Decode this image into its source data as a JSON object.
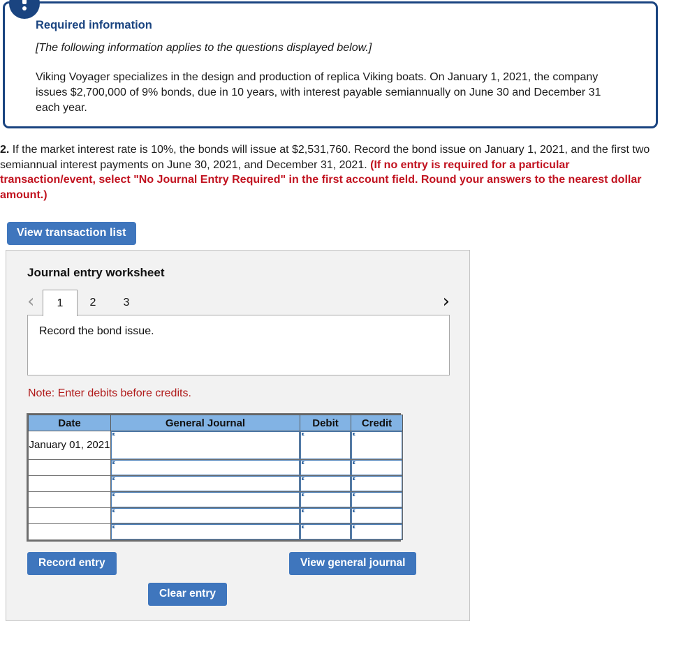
{
  "required_info": {
    "badge_icon": "exclamation-circle-icon",
    "title": "Required information",
    "applies_note": "[The following information applies to the questions displayed below.]",
    "body": "Viking Voyager specializes in the design and production of replica Viking boats. On January 1, 2021, the company issues $2,700,000 of 9% bonds, due in 10 years, with interest payable semiannually on June 30 and December 31 each year.",
    "border_color": "#1a4480",
    "title_color": "#1a4480"
  },
  "question": {
    "number": "2.",
    "text_part1": " If the market interest rate is 10%, the bonds will issue at $2,531,760. Record the bond issue on January 1, 2021, and the first two semiannual interest payments on June 30, 2021, and December 31, 2021. ",
    "emphasis": "(If no entry is required for a particular transaction/event, select \"No Journal Entry Required\" in the first account field. Round your answers to the nearest dollar amount.)",
    "emphasis_color": "#c1121f"
  },
  "toolbar": {
    "view_transaction_list_label": "View transaction list"
  },
  "worksheet": {
    "title": "Journal entry worksheet",
    "prev_icon": "chevron-left-icon",
    "next_icon": "chevron-right-icon",
    "tabs": [
      {
        "label": "1",
        "active": true
      },
      {
        "label": "2",
        "active": false
      },
      {
        "label": "3",
        "active": false
      }
    ],
    "entry_description": "Record the bond issue.",
    "note": "Note: Enter debits before credits.",
    "note_color": "#b01a1a",
    "table": {
      "headers": [
        "Date",
        "General Journal",
        "Debit",
        "Credit"
      ],
      "header_bg": "#82b3e4",
      "rows": [
        {
          "date": "January 01, 2021",
          "general_journal": "",
          "debit": "",
          "credit": ""
        },
        {
          "date": "",
          "general_journal": "",
          "debit": "",
          "credit": ""
        },
        {
          "date": "",
          "general_journal": "",
          "debit": "",
          "credit": ""
        },
        {
          "date": "",
          "general_journal": "",
          "debit": "",
          "credit": ""
        },
        {
          "date": "",
          "general_journal": "",
          "debit": "",
          "credit": ""
        },
        {
          "date": "",
          "general_journal": "",
          "debit": "",
          "credit": ""
        }
      ]
    },
    "buttons": {
      "record_entry": "Record entry",
      "clear_entry": "Clear entry",
      "view_general_journal": "View general journal",
      "color": "#3f76bd"
    }
  }
}
